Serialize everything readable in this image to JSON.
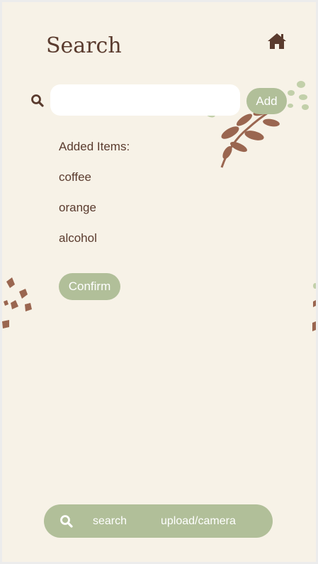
{
  "header": {
    "title": "Search",
    "home_icon": "home-icon"
  },
  "search_bar": {
    "icon": "search-icon",
    "input_value": "",
    "input_placeholder": "",
    "add_label": "Add"
  },
  "added_items": {
    "heading": "Added Items:",
    "items": [
      "coffee",
      "orange",
      "alcohol"
    ]
  },
  "confirm_label": "Confirm",
  "bottom_nav": {
    "icon": "search-icon",
    "search_label": "search",
    "upload_label": "upload/camera"
  },
  "colors": {
    "background": "#f7f2e7",
    "accent": "#b1bf99",
    "text": "#5a3b2e",
    "leaf_brown": "#9a6650",
    "leaf_green": "#c2d0aa"
  }
}
